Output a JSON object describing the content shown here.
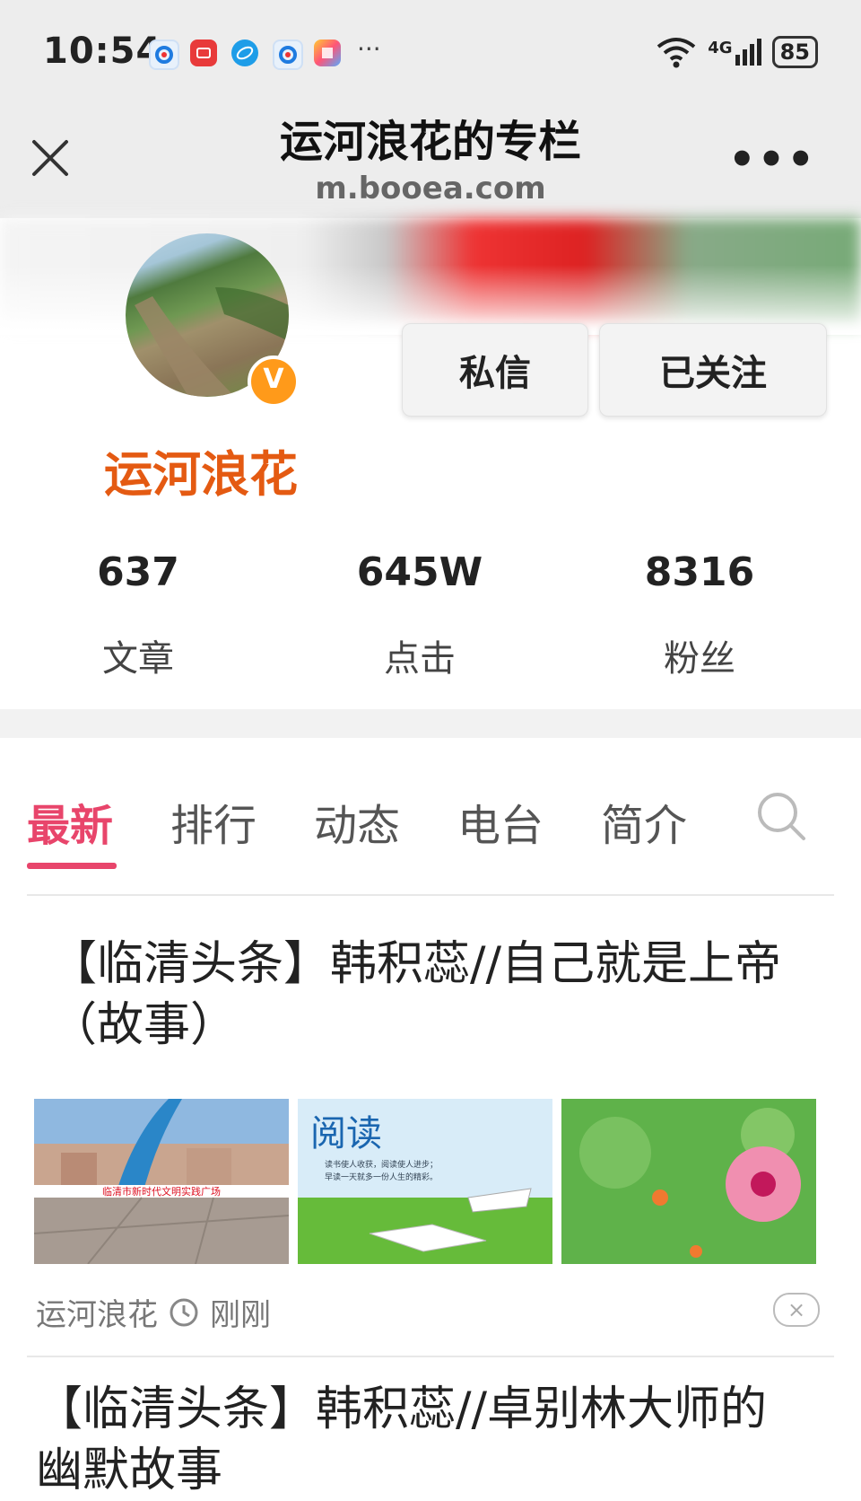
{
  "status_bar": {
    "time": "10:54",
    "app_icons": [
      "app-icon-blue-circle",
      "huawei-appgallery-icon",
      "browser-icon",
      "app-icon-blue-circle-2",
      "app-icon-colorful"
    ],
    "more": "···",
    "network": "4G",
    "battery": "85"
  },
  "header": {
    "title": "运河浪花的专栏",
    "url": "m.booea.com",
    "more": "•••"
  },
  "profile": {
    "name": "运河浪花",
    "message_button": "私信",
    "follow_button": "已关注",
    "stats": [
      {
        "value": "637",
        "label": "文章"
      },
      {
        "value": "645W",
        "label": "点击"
      },
      {
        "value": "8316",
        "label": "粉丝"
      }
    ]
  },
  "tabs": [
    {
      "label": "最新",
      "active": true
    },
    {
      "label": "排行",
      "active": false
    },
    {
      "label": "动态",
      "active": false
    },
    {
      "label": "电台",
      "active": false
    },
    {
      "label": "简介",
      "active": false
    }
  ],
  "articles": [
    {
      "title_line1": "【临清头条】韩积蕊//自己就是上帝",
      "title_line2": "（故事）",
      "thumb_texts": {
        "banner": "临清市新时代文明实践广场",
        "reading_title": "阅读",
        "reading_line1": "读书使人收获，阅读使人进步；",
        "reading_line2": "早读一天就多一份人生的精彩。"
      },
      "author": "运河浪花",
      "time": "刚刚",
      "dismiss": "×"
    },
    {
      "title_line1": "【临清头条】韩积蕊//卓别林大师的",
      "title_line2": "幽默故事"
    }
  ],
  "colors": {
    "accent": "#e8456b",
    "username": "#e45a12",
    "header_bg": "#ededed"
  }
}
